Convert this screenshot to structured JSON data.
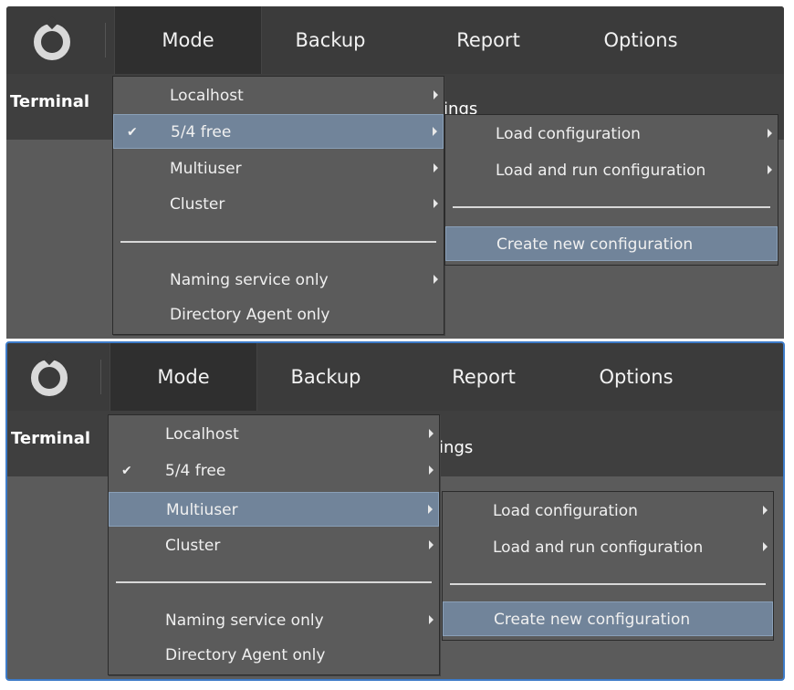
{
  "app": {
    "top_menu": [
      "Mode",
      "Backup",
      "Report",
      "Options"
    ],
    "subbar_left": "Terminal",
    "subbar_right_partial": "tings"
  },
  "mode_menu": {
    "items": [
      {
        "label": "Localhost",
        "has_submenu": true
      },
      {
        "label": "5/4 free",
        "has_submenu": true,
        "checked": true
      },
      {
        "label": "Multiuser",
        "has_submenu": true
      },
      {
        "label": "Cluster",
        "has_submenu": true
      },
      {
        "label": "Naming service only",
        "has_submenu": true
      },
      {
        "label": "Directory Agent only",
        "has_submenu": false
      }
    ]
  },
  "config_submenu": {
    "items": [
      {
        "label": "Load configuration",
        "has_submenu": true
      },
      {
        "label": "Load and run configuration",
        "has_submenu": true
      },
      {
        "label": "Create new configuration",
        "has_submenu": false
      }
    ]
  },
  "screens": [
    {
      "highlighted_mode_item": "5/4 free",
      "highlighted_submenu_item": "Create new configuration"
    },
    {
      "highlighted_mode_item": "Multiuser",
      "highlighted_submenu_item": "Create new configuration"
    }
  ],
  "colors": {
    "highlight": "#71849a",
    "panel_bg": "#5b5b5b",
    "topbar_bg": "#3b3b3b",
    "accent_border": "#3d7bc8"
  }
}
